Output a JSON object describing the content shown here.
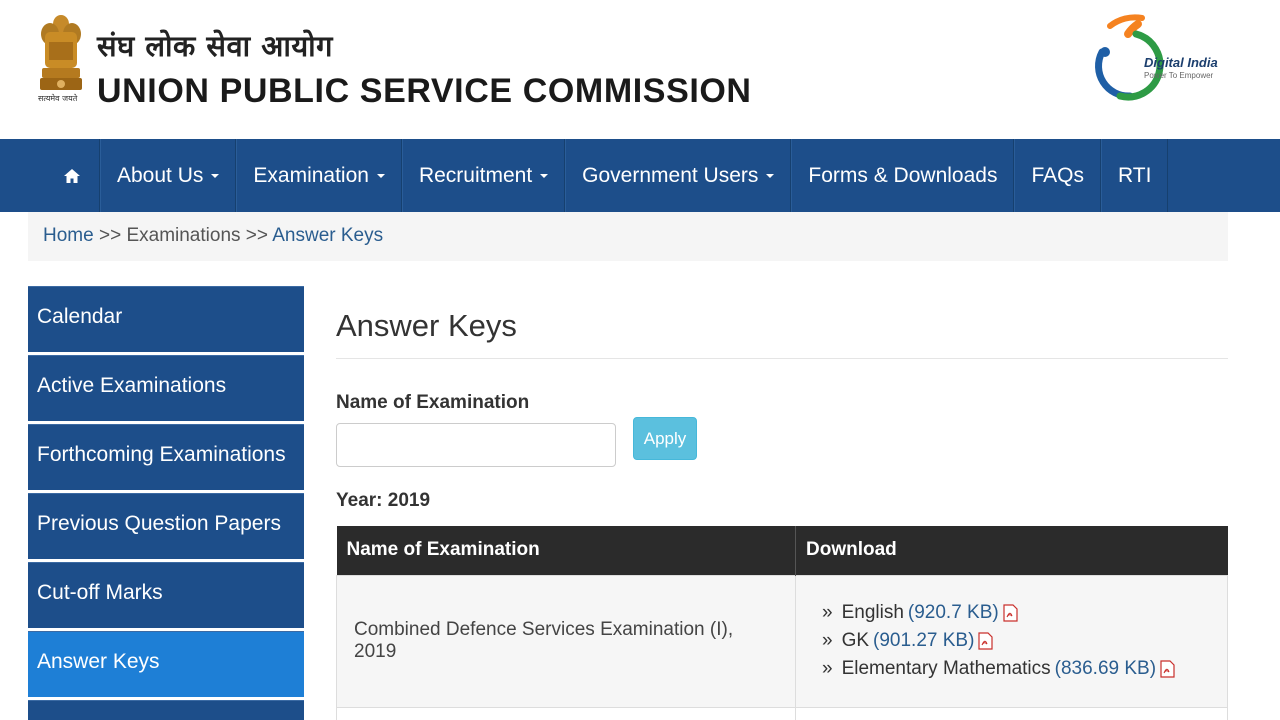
{
  "header": {
    "hindi_title": "संघ लोक सेवा आयोग",
    "english_title": "UNION PUBLIC SERVICE COMMISSION",
    "emblem_caption": "सत्यमेव जयते",
    "digital_india": {
      "title": "Digital India",
      "tagline": "Power To Empower"
    }
  },
  "nav": {
    "items": [
      {
        "label": "About Us",
        "dropdown": true
      },
      {
        "label": "Examination",
        "dropdown": true
      },
      {
        "label": "Recruitment",
        "dropdown": true
      },
      {
        "label": "Government Users",
        "dropdown": true
      },
      {
        "label": "Forms & Downloads",
        "dropdown": false
      },
      {
        "label": "FAQs",
        "dropdown": false
      },
      {
        "label": "RTI",
        "dropdown": false
      }
    ]
  },
  "breadcrumb": {
    "home": "Home",
    "sep1": ">>",
    "middle": "Examinations",
    "sep2": ">>",
    "current": "Answer Keys"
  },
  "sidebar": {
    "items": [
      {
        "label": "Calendar",
        "active": false
      },
      {
        "label": "Active Examinations",
        "active": false
      },
      {
        "label": "Forthcoming Examinations",
        "active": false
      },
      {
        "label": "Previous Question Papers",
        "active": false
      },
      {
        "label": "Cut-off Marks",
        "active": false
      },
      {
        "label": "Answer Keys",
        "active": true
      }
    ]
  },
  "main": {
    "title": "Answer Keys",
    "field_label": "Name of Examination",
    "input_value": "",
    "input_placeholder": "",
    "apply_label": "Apply",
    "year_label": "Year: 2019",
    "table": {
      "headers": [
        "Name of Examination",
        "Download"
      ],
      "rows": [
        {
          "exam": "Combined Defence Services Examination (I), 2019",
          "downloads": [
            {
              "bullet": "»",
              "name": "English",
              "size": "(920.7 KB)"
            },
            {
              "bullet": "»",
              "name": "GK",
              "size": "(901.27 KB)"
            },
            {
              "bullet": "»",
              "name": "Elementary Mathematics",
              "size": "(836.69 KB)"
            }
          ]
        }
      ]
    }
  },
  "colors": {
    "nav_bg": "#1d4e8a",
    "sidebar_active": "#1e7fd6",
    "apply_btn": "#5bc0de",
    "table_header": "#2b2b2b",
    "link": "#2a5d8f"
  }
}
